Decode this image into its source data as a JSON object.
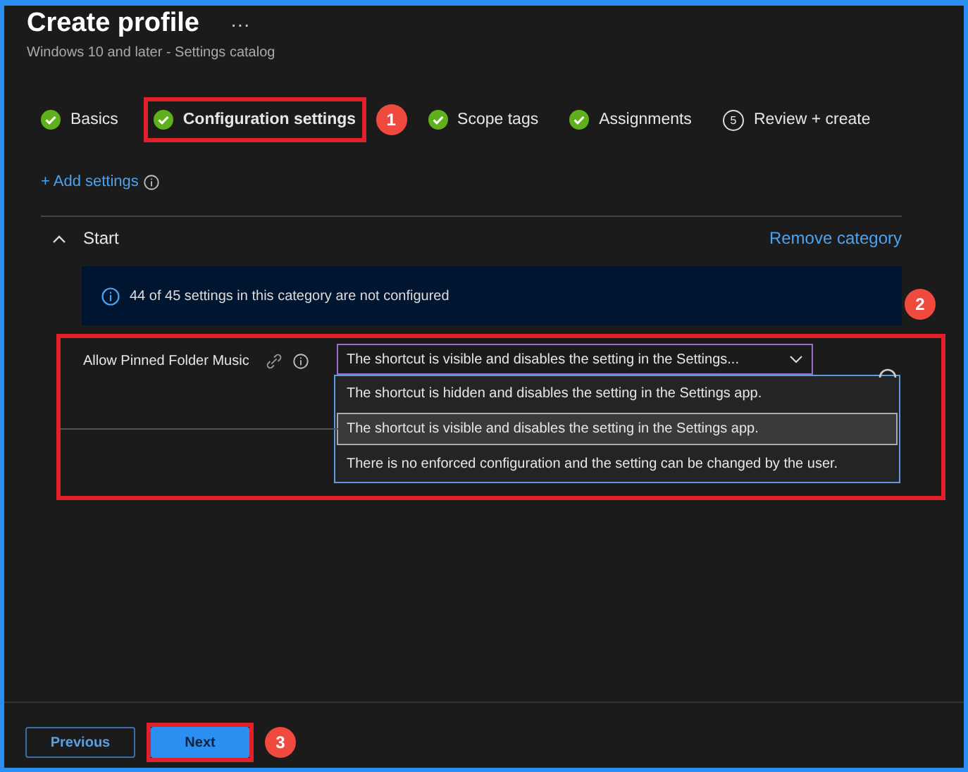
{
  "header": {
    "title": "Create profile",
    "more": "···",
    "subtitle": "Windows 10 and later - Settings catalog"
  },
  "steps": [
    {
      "label": "Basics",
      "kind": "done",
      "selected": false
    },
    {
      "label": "Configuration settings",
      "kind": "done",
      "selected": true
    },
    {
      "label": "Scope tags",
      "kind": "done",
      "selected": false
    },
    {
      "label": "Assignments",
      "kind": "done",
      "selected": false
    },
    {
      "label": "Review + create",
      "kind": "number",
      "number": "5",
      "selected": false
    }
  ],
  "add_settings": "+ Add settings",
  "category": {
    "name": "Start",
    "expanded": true,
    "remove": "Remove category",
    "info": "44 of 45 settings in this category are not configured",
    "setting": {
      "label": "Allow Pinned Folder Music",
      "value": "The shortcut is visible and disables the setting in the Settings...",
      "options": [
        {
          "label": "The shortcut is hidden and disables the setting in the Settings app.",
          "selected": false
        },
        {
          "label": "The shortcut is visible and disables the setting in the Settings app.",
          "selected": true
        },
        {
          "label": "There is no enforced configuration and the setting can be changed by the user.",
          "selected": false
        }
      ]
    }
  },
  "footer": {
    "previous": "Previous",
    "next": "Next"
  },
  "annotations": [
    {
      "label": "1"
    },
    {
      "label": "2"
    },
    {
      "label": "3"
    }
  ]
}
